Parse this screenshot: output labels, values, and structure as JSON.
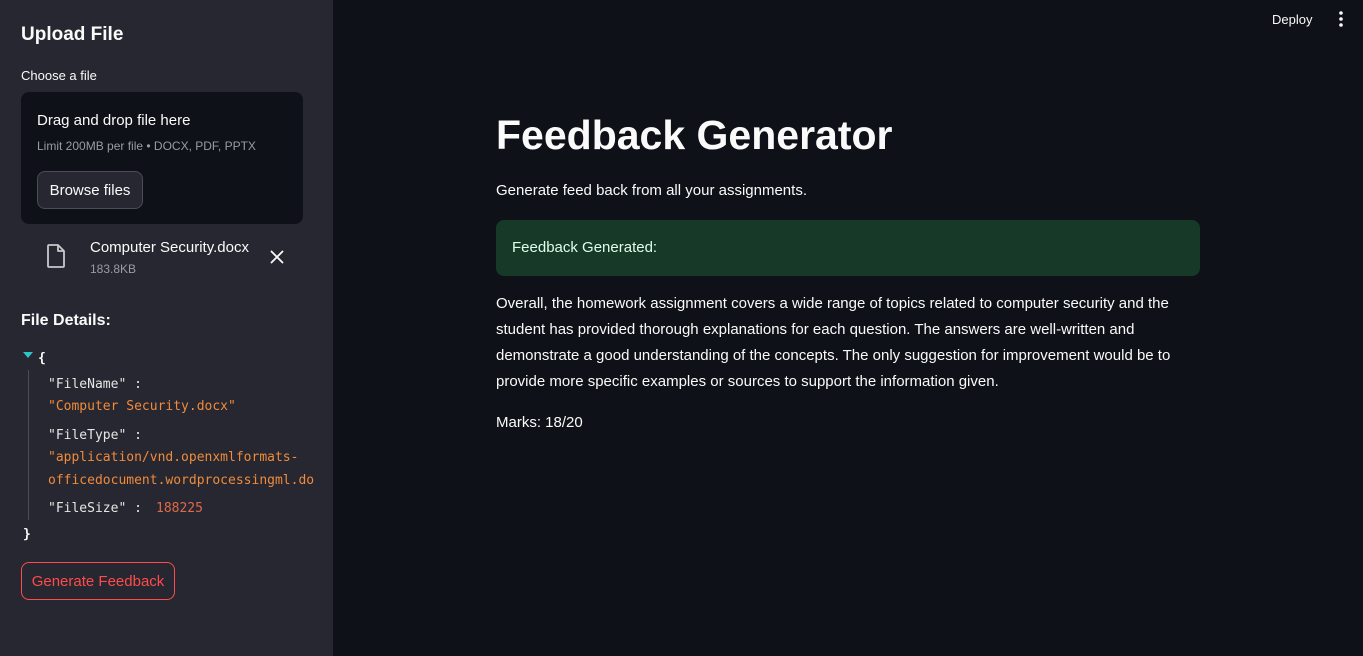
{
  "sidebar": {
    "title": "Upload File",
    "uploader": {
      "label": "Choose a file",
      "drop_text": "Drag and drop file here",
      "limit_text": "Limit 200MB per file • DOCX, PDF, PPTX",
      "browse_label": "Browse files"
    },
    "uploaded_file": {
      "name": "Computer Security.docx",
      "size": "183.8KB",
      "icon": "file-icon"
    },
    "details_title": "File Details:",
    "json": {
      "open_brace": "{",
      "close_brace": "}",
      "filename_key": "\"FileName\" :",
      "filename_value": "\"Computer Security.docx\"",
      "filetype_key": "\"FileType\" :",
      "filetype_value_line1": "\"application/vnd.openxmlformats-",
      "filetype_value_line2": "officedocument.wordprocessingml.do",
      "filesize_key": "\"FileSize\" :",
      "filesize_value": "188225"
    },
    "generate_label": "Generate Feedback"
  },
  "header": {
    "deploy_label": "Deploy",
    "menu_icon": "more-vertical-icon"
  },
  "main": {
    "title": "Feedback Generator",
    "subtitle": "Generate feed back from all your assignments.",
    "alert_text": "Feedback Generated:",
    "feedback_text": "Overall, the homework assignment covers a wide range of topics related to computer security and the student has provided thorough explanations for each question. The answers are well-written and demonstrate a good understanding of the concepts. The only suggestion for improvement would be to provide more specific examples or sources to support the information given.",
    "marks": "Marks: 18/20"
  },
  "colors": {
    "background": "#0e1117",
    "sidebar": "#262730",
    "accent_red": "#ff4b4b",
    "success_bg": "#173928",
    "json_string": "#f08a3c",
    "json_number": "#e0684a"
  }
}
